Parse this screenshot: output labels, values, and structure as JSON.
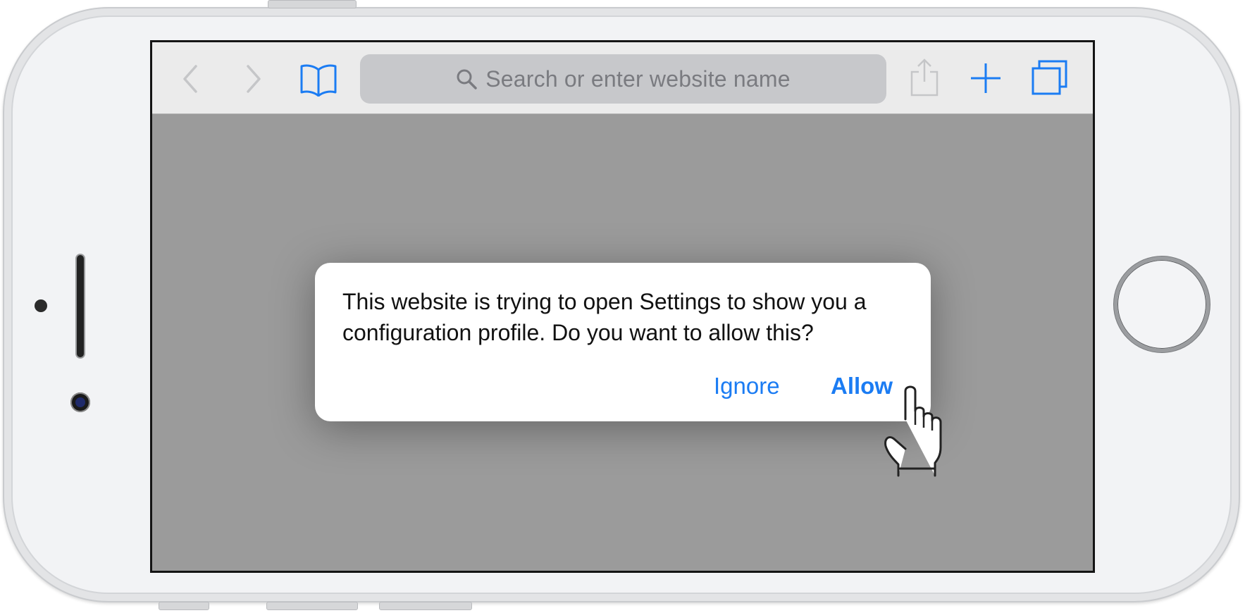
{
  "device": {
    "name": "iPhone",
    "orientation": "landscape"
  },
  "browser": {
    "toolbar": {
      "back_icon": "chevron-left-icon",
      "forward_icon": "chevron-right-icon",
      "bookmarks_icon": "open-book-icon",
      "search": {
        "icon": "search-icon",
        "placeholder": "Search or enter website name"
      },
      "share_icon": "share-icon",
      "new_tab_icon": "plus-icon",
      "tabs_icon": "tabs-icon"
    }
  },
  "alert": {
    "message": "This website is trying to open Settings to show you a configuration profile. Do you want to allow this?",
    "ignore_label": "Ignore",
    "allow_label": "Allow"
  },
  "overlay": {
    "pointer_icon": "tap-hand-icon"
  },
  "colors": {
    "accent": "#1b7cf3",
    "disabled_icon": "#c5c6c8",
    "dimmed_background": "#9b9b9b",
    "toolbar": "#ebebeb",
    "search_field": "#c7c8cb"
  }
}
